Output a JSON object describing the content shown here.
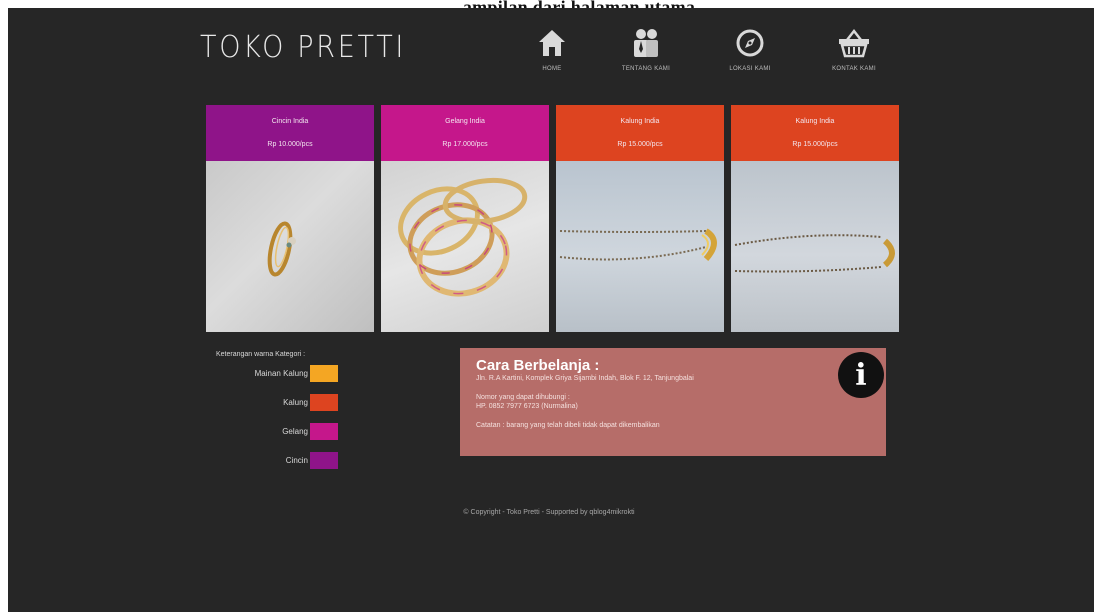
{
  "caption": "ampilan dari halaman utama",
  "logo": {
    "text": "TOKO PRETTI"
  },
  "nav": [
    {
      "label": "HOME",
      "icon": "home-icon"
    },
    {
      "label": "TENTANG KAMI",
      "icon": "people-icon"
    },
    {
      "label": "LOKASI KAMI",
      "icon": "compass-icon"
    },
    {
      "label": "KONTAK KAMI",
      "icon": "basket-icon"
    }
  ],
  "products": [
    {
      "name": "Cincin India",
      "price": "Rp 10.000/pcs",
      "color": "#8f1489",
      "image": "ring-image"
    },
    {
      "name": "Gelang India",
      "price": "Rp 17.000/pcs",
      "color": "#c5178b",
      "image": "bangles-image"
    },
    {
      "name": "Kalung India",
      "price": "Rp 15.000/pcs",
      "color": "#dd4420",
      "image": "necklace-image"
    },
    {
      "name": "Kalung India",
      "price": "Rp 15.000/pcs",
      "color": "#dd4420",
      "image": "necklace-image"
    }
  ],
  "legend": {
    "title": "Keterangan warna Kategori :",
    "items": [
      {
        "label": "Mainan Kalung",
        "color": "#f4a623"
      },
      {
        "label": "Kalung",
        "color": "#dd4420"
      },
      {
        "label": "Gelang",
        "color": "#c5178b"
      },
      {
        "label": "Cincin",
        "color": "#8f1489"
      }
    ]
  },
  "info": {
    "title": "Cara Berbelanja :",
    "address": "Jln. R.A Kartini, Komplek Griya Sijambi Indah, Blok F. 12, Tanjungbalai",
    "phone_label": "Nomor yang dapat dihubungi :",
    "phone": "HP. 0852 7977 6723 (Nurmalina)",
    "note": "Catatan : barang yang telah dibeli tidak dapat dikembalikan",
    "icon": "info-icon",
    "color": "#b66d69"
  },
  "footer": {
    "text": "© Copyright - Toko Pretti - Supported by qblog4mikrokti"
  }
}
